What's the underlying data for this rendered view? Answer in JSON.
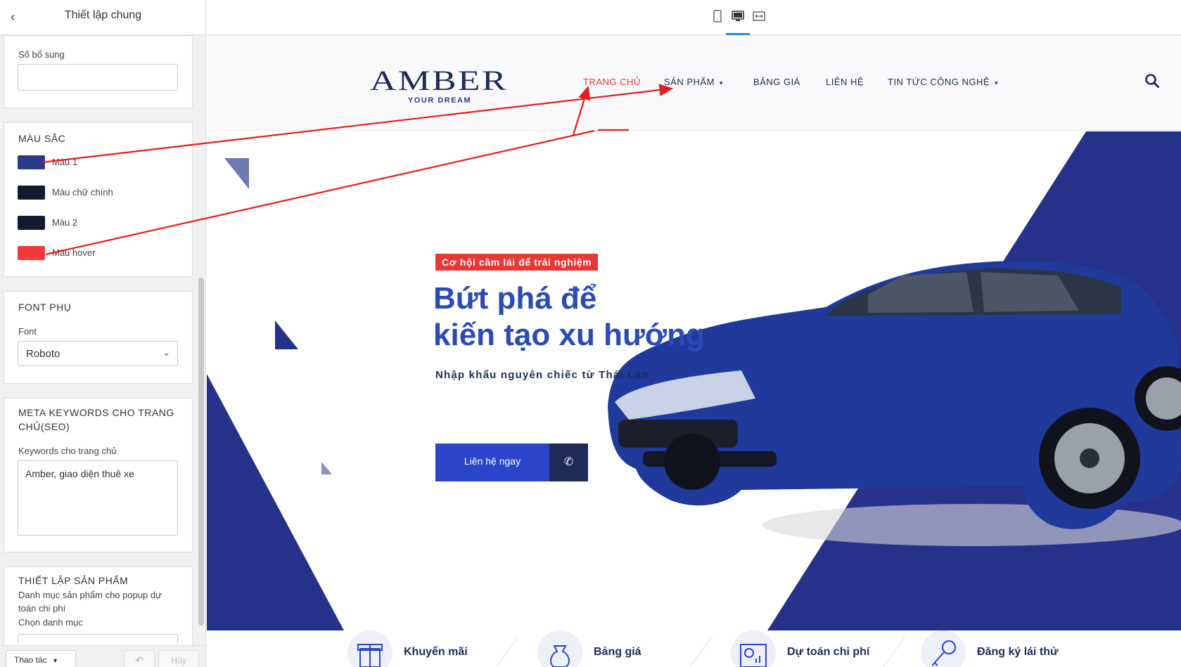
{
  "sidebar": {
    "title": "Thiết lập chung",
    "extra_label": "Số bổ sung",
    "extra_value": "",
    "colors": {
      "heading": "MÀU SẮC",
      "items": [
        {
          "label": "Màu 1",
          "hex": "#2c3a8c"
        },
        {
          "label": "Màu chữ chính",
          "hex": "#141a33"
        },
        {
          "label": "Màu 2",
          "hex": "#141a33"
        },
        {
          "label": "Màu hover",
          "hex": "#f23a3a"
        }
      ]
    },
    "font": {
      "heading": "FONT PHỤ",
      "label": "Font",
      "value": "Roboto"
    },
    "meta": {
      "heading_line1": "META KEYWORDS CHO TRANG",
      "heading_line2": "CHỦ(SEO)",
      "label": "Keywords cho trang chủ",
      "value": "Amber, giao diện thuê xe"
    },
    "product": {
      "heading": "THIẾT LẬP SẢN PHẨM",
      "desc_line1": "Danh mục sản phẩm cho popup dự",
      "desc_line2": "toán chi phí",
      "choose": "Chọn danh mục"
    },
    "footer": {
      "actions": "Thao tác",
      "cancel": "Hủy"
    }
  },
  "toolbar": {
    "icons": [
      "tablet-icon",
      "desktop-icon",
      "fullwidth-icon"
    ],
    "active": "desktop-icon"
  },
  "site": {
    "logo": {
      "brand": "AMBER",
      "tagline": "YOUR DREAM"
    },
    "nav": [
      {
        "label": "TRANG CHỦ",
        "active": true
      },
      {
        "label": "SẢN PHẨM",
        "dropdown": true
      },
      {
        "label": "BẢNG GIÁ"
      },
      {
        "label": "LIÊN HỆ"
      },
      {
        "label": "TIN TỨC CÔNG NGHỆ",
        "dropdown": true
      }
    ],
    "hero": {
      "badge": "Cơ hội cầm lái để trải nghiệm",
      "title_line1": "Bứt phá để",
      "title_line2": "kiến tạo xu hướng",
      "subtitle": "Nhập khẩu nguyên chiếc từ Thái Lan",
      "cta": "Liên hệ ngay"
    },
    "features": [
      {
        "label": "Khuyến mãi",
        "icon": "gift-icon"
      },
      {
        "label": "Bảng giá",
        "icon": "money-bag-icon"
      },
      {
        "label": "Dự toán chi phí",
        "icon": "chart-board-icon"
      },
      {
        "label": "Đăng ký lái thử",
        "icon": "key-icon"
      }
    ]
  },
  "colors": {
    "primary": "#2c3a8c",
    "dark": "#1e2b57",
    "accent": "#e53935",
    "button": "#2a45c9"
  }
}
